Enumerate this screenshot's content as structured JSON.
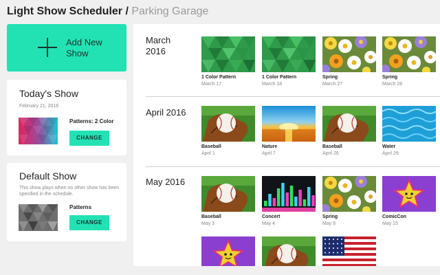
{
  "header": {
    "app_title": "Light Show Scheduler /",
    "location": "Parking Garage"
  },
  "add_show": {
    "label": "Add New Show"
  },
  "today_show": {
    "title": "Today's Show",
    "date": "February 21, 2016",
    "pattern": "Patterns: 2 Color",
    "change_label": "CHANGE"
  },
  "default_show": {
    "title": "Default Show",
    "description": "This show plays when no other show has been specified in the schedule.",
    "pattern": "Patterns",
    "change_label": "CHANGE"
  },
  "months": [
    {
      "label": "March 2016",
      "shows": [
        {
          "name": "1 Color Pattern",
          "date": "March 17",
          "thumb": "green-pattern"
        },
        {
          "name": "1 Color Pattern",
          "date": "March 18",
          "thumb": "green-pattern"
        },
        {
          "name": "Spring",
          "date": "March 27",
          "thumb": "spring-flowers"
        },
        {
          "name": "Spring",
          "date": "March 28",
          "thumb": "spring-flowers"
        }
      ]
    },
    {
      "label": "April 2016",
      "shows": [
        {
          "name": "Baseball",
          "date": "April 1",
          "thumb": "baseball"
        },
        {
          "name": "Nature",
          "date": "April 7",
          "thumb": "sunset"
        },
        {
          "name": "Baseball",
          "date": "April 26",
          "thumb": "baseball"
        },
        {
          "name": "Water",
          "date": "April 29",
          "thumb": "water"
        }
      ]
    },
    {
      "label": "May 2016",
      "shows": [
        {
          "name": "Baseball",
          "date": "May 3",
          "thumb": "baseball"
        },
        {
          "name": "Concert",
          "date": "May 4",
          "thumb": "equalizer"
        },
        {
          "name": "Spring",
          "date": "May 8",
          "thumb": "spring-flowers"
        },
        {
          "name": "ComicCon",
          "date": "May 15",
          "thumb": "rainbow-star"
        },
        {
          "name": "",
          "date": "",
          "thumb": "rainbow-star"
        },
        {
          "name": "",
          "date": "",
          "thumb": "baseball"
        },
        {
          "name": "",
          "date": "",
          "thumb": "american-flag"
        }
      ]
    }
  ],
  "colors": {
    "accent": "#22e2b4",
    "background": "#f0f0f0"
  }
}
